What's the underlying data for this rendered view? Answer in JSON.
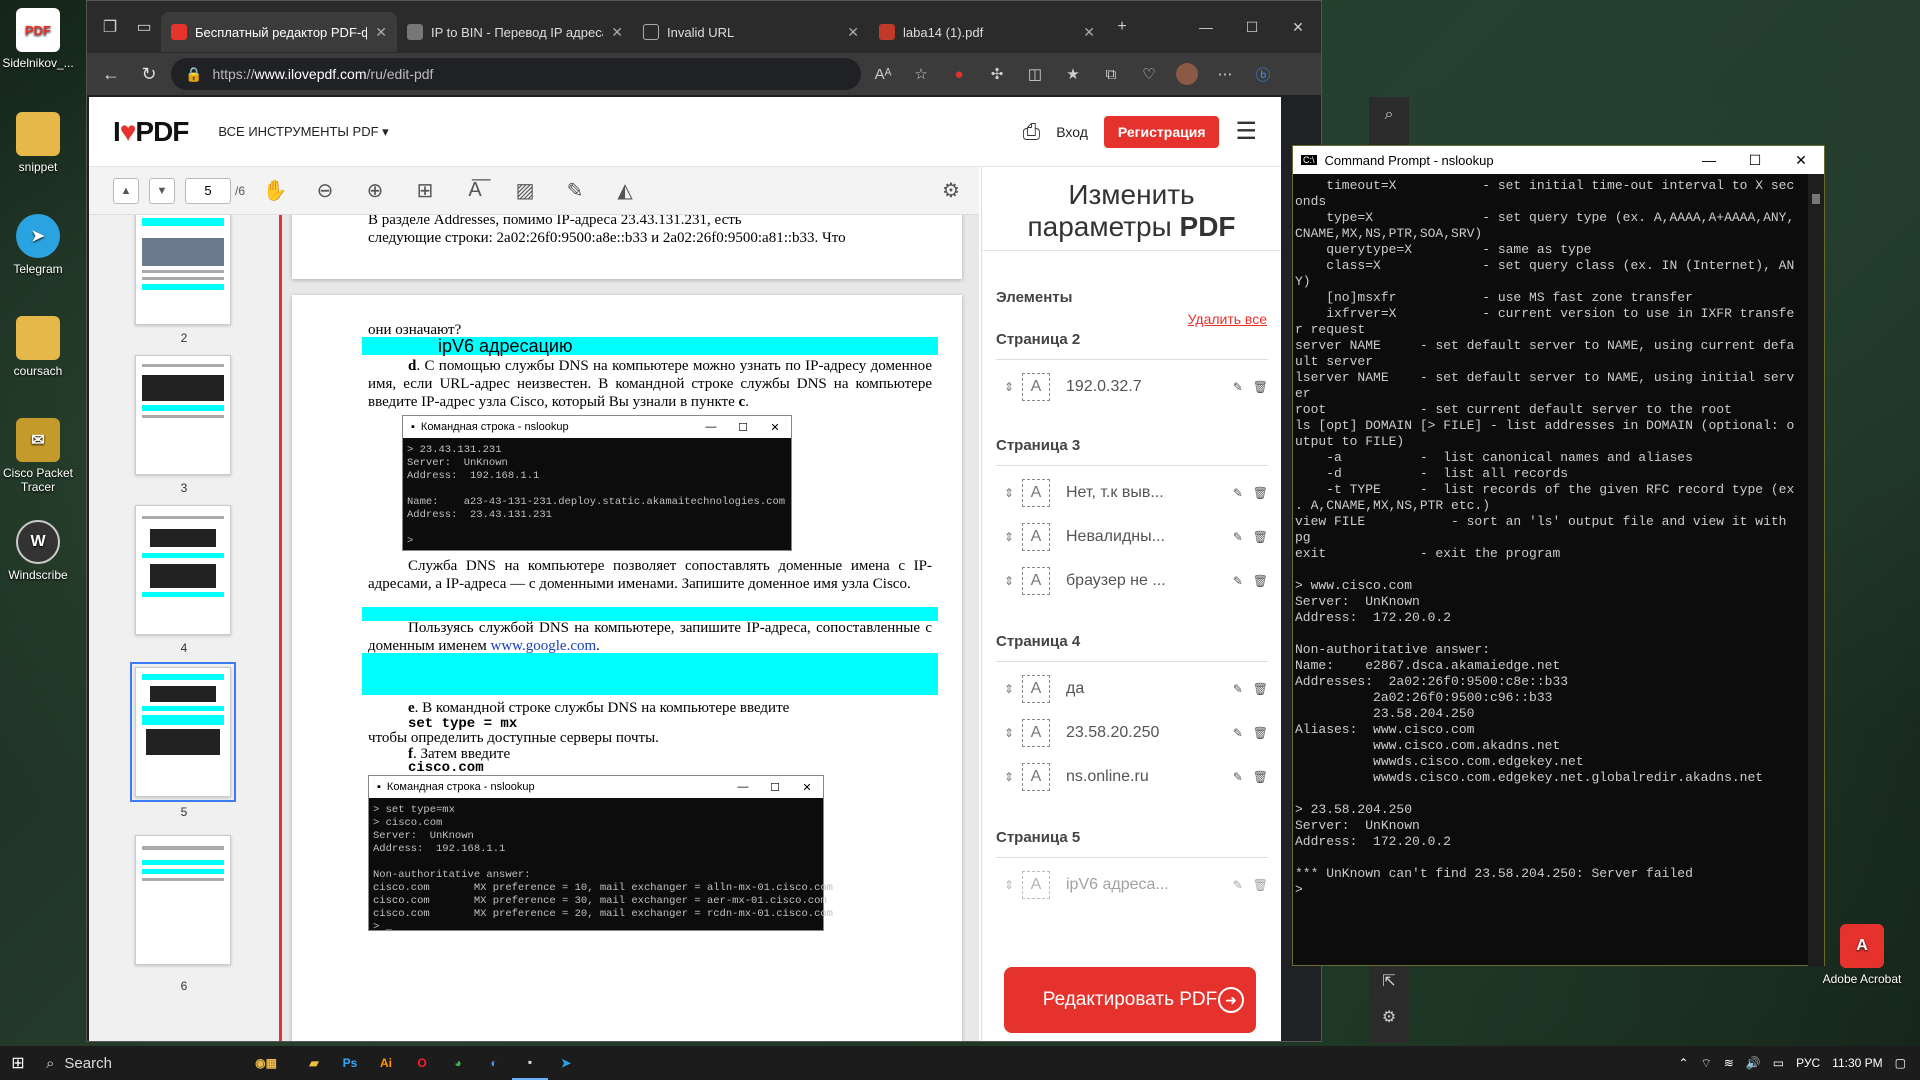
{
  "desktop": {
    "icons": [
      {
        "label": "Sidelnikov_...",
        "glyph": "PDF",
        "color": "#e5322d"
      },
      {
        "label": "snippet",
        "glyph": "",
        "color": "#e6b84a"
      },
      {
        "label": "Telegram",
        "glyph": "➤",
        "color": "#2aa3e0"
      },
      {
        "label": "coursach",
        "glyph": "",
        "color": "#e6b84a"
      },
      {
        "label": "Cisco Packet Tracer",
        "glyph": "✉",
        "color": "#c49a2b"
      },
      {
        "label": "Windscribe",
        "glyph": "W",
        "color": "#333"
      },
      {
        "label": "Adobe Acrobat",
        "glyph": "A",
        "color": "#e5322d"
      }
    ]
  },
  "browser": {
    "tabs": [
      {
        "label": "Бесплатный редактор PDF-фай",
        "active": true,
        "color": "#e5322d"
      },
      {
        "label": "IP to BIN - Перевод IP адреса",
        "active": false,
        "color": "#666"
      },
      {
        "label": "Invalid URL",
        "active": false,
        "color": "#666"
      },
      {
        "label": "laba14 (1).pdf",
        "active": false,
        "color": "#c0392b"
      }
    ],
    "url_prefix": "https://",
    "url_host": "www.ilovepdf.com",
    "url_path": "/ru/edit-pdf"
  },
  "site": {
    "logo_i": "I",
    "logo_heart": "♥",
    "logo_pdf": "PDF",
    "tools_menu": "ВСЕ ИНСТРУМЕНТЫ PDF ▾",
    "login": "Вход",
    "signup": "Регистрация"
  },
  "toolbar": {
    "page": "5",
    "total": "/6"
  },
  "thumbs": [
    "2",
    "3",
    "4",
    "5",
    "6"
  ],
  "doc": {
    "p1_line1": "В разделе Addresses, помимо IP-адреса 23.43.131.231, есть",
    "p1_line2": "следующие строки: 2a02:26f0:9500:a8e::b33 и 2a02:26f0:9500:a81::b33. Что",
    "p2_line1": "они означают?",
    "heading": "ipV6 адресацию",
    "d_label": "d",
    "d_text": ". С помощью службы DNS на компьютере можно узнать по IP-адресу доменное имя, если URL-адрес неизвестен. В командной строке службы DNS на компьютере введите IP-адрес узла Cisco, который Вы узнали в пункте ",
    "d_ref": "c",
    "d_end": ".",
    "cmd1_title": "Командная строка - nslookup",
    "cmd1_text": "> 23.43.131.231\nServer:  UnKnown\nAddress:  192.168.1.1\n\nName:    a23-43-131-231.deploy.static.akamaitechnologies.com\nAddress:  23.43.131.231\n\n>",
    "dns_para": "Служба DNS на компьютере позволяет сопоставлять доменные имена с IP-адресами, а IP-адреса — с доменными именами. Запишите доменное имя узла Cisco.",
    "google_para_a": "Пользуясь службой DNS на компьютере, запишите IP-адреса, сопоставленные с доменным именем ",
    "google_link": "www.google.com",
    "google_para_b": ".",
    "e_label": "e",
    "e_text": ". В командной строке службы DNS на компьютере введите",
    "e_cmd": "set type = mx",
    "e_after": "чтобы определить доступные серверы почты.",
    "f_label": "f",
    "f_text": ". Затем введите",
    "f_cmd": "cisco.com",
    "cmd2_title": "Командная строка - nslookup",
    "cmd2_text": "> set type=mx\n> cisco.com\nServer:  UnKnown\nAddress:  192.168.1.1\n\nNon-authoritative answer:\ncisco.com       MX preference = 10, mail exchanger = alln-mx-01.cisco.com\ncisco.com       MX preference = 30, mail exchanger = aer-mx-01.cisco.com\ncisco.com       MX preference = 20, mail exchanger = rcdn-mx-01.cisco.com\n> _"
  },
  "panel": {
    "title_a": "Изменить",
    "title_b": "параметры ",
    "title_c": "PDF",
    "elements": "Элементы",
    "delete_all": "Удалить все",
    "pages": [
      {
        "name": "Страница 2",
        "items": [
          "192.0.32.7"
        ]
      },
      {
        "name": "Страница 3",
        "items": [
          "Нет, т.к выв...",
          "Невалидны...",
          "браузер не ..."
        ]
      },
      {
        "name": "Страница 4",
        "items": [
          "да",
          "23.58.20.250",
          "ns.online.ru"
        ]
      },
      {
        "name": "Страница 5",
        "items": [
          "ipV6 адреса..."
        ]
      }
    ],
    "edit_button": "Редактировать PDF"
  },
  "cmd": {
    "title": "Command Prompt - nslookup",
    "text": "    timeout=X           - set initial time-out interval to X sec\nonds\n    type=X              - set query type (ex. A,AAAA,A+AAAA,ANY,\nCNAME,MX,NS,PTR,SOA,SRV)\n    querytype=X         - same as type\n    class=X             - set query class (ex. IN (Internet), AN\nY)\n    [no]msxfr           - use MS fast zone transfer\n    ixfrver=X           - current version to use in IXFR transfe\nr request\nserver NAME     - set default server to NAME, using current defa\nult server\nlserver NAME    - set default server to NAME, using initial serv\ner\nroot            - set current default server to the root\nls [opt] DOMAIN [> FILE] - list addresses in DOMAIN (optional: o\nutput to FILE)\n    -a          -  list canonical names and aliases\n    -d          -  list all records\n    -t TYPE     -  list records of the given RFC record type (ex\n. A,CNAME,MX,NS,PTR etc.)\nview FILE           - sort an 'ls' output file and view it with\npg\nexit            - exit the program\n\n> www.cisco.com\nServer:  UnKnown\nAddress:  172.20.0.2\n\nNon-authoritative answer:\nName:    e2867.dsca.akamaiedge.net\nAddresses:  2a02:26f0:9500:c8e::b33\n          2a02:26f0:9500:c96::b33\n          23.58.204.250\nAliases:  www.cisco.com\n          www.cisco.com.akadns.net\n          wwwds.cisco.com.edgekey.net\n          wwwds.cisco.com.edgekey.net.globalredir.akadns.net\n\n> 23.58.204.250\nServer:  UnKnown\nAddress:  172.20.0.2\n\n*** UnKnown can't find 23.58.204.250: Server failed\n>"
  },
  "taskbar": {
    "search": "Search",
    "lang": "РУС",
    "time": "11:30 PM"
  }
}
